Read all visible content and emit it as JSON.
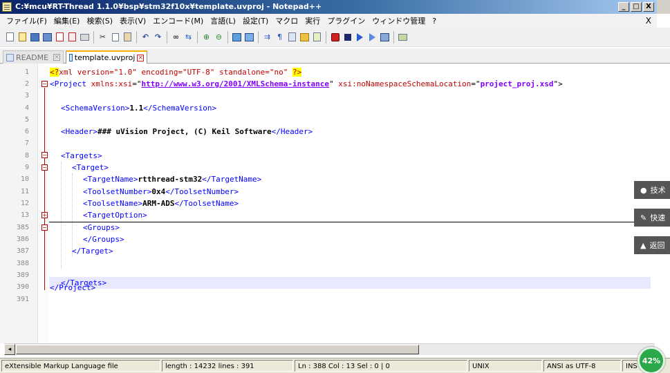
{
  "window": {
    "title": "C:¥mcu¥RT-Thread 1.1.0¥bsp¥stm32f10x¥template.uvproj - Notepad++",
    "buttons": [
      "_",
      "□",
      "X"
    ]
  },
  "menubar": {
    "items": [
      "ファイル(F)",
      "編集(E)",
      "検索(S)",
      "表示(V)",
      "エンコード(M)",
      "言語(L)",
      "設定(T)",
      "マクロ",
      "実行",
      "プラグイン",
      "ウィンドウ管理",
      "?"
    ],
    "close_label": "X"
  },
  "toolbar": {
    "icons": [
      "new-file-icon",
      "open-file-icon",
      "save-icon",
      "save-all-icon",
      "close-icon",
      "close-all-icon",
      "print-icon",
      "cut-icon",
      "copy-icon",
      "paste-icon",
      "undo-icon",
      "redo-icon",
      "find-icon",
      "replace-icon",
      "zoom-in-icon",
      "zoom-out-icon",
      "sync-v-icon",
      "sync-h-icon",
      "word-wrap-icon",
      "show-all-chars-icon",
      "indent-guide-icon",
      "doc-map-icon",
      "function-list-icon",
      "record-macro-icon",
      "stop-macro-icon",
      "play-macro-icon",
      "run-macro-multiple-icon",
      "save-macro-icon",
      "spellcheck-icon"
    ]
  },
  "tabs": [
    {
      "label": "README",
      "active": false
    },
    {
      "label": "template.uvproj",
      "active": true
    }
  ],
  "editor": {
    "line_numbers": [
      "1",
      "2",
      "3",
      "4",
      "5",
      "6",
      "7",
      "8",
      "9",
      "10",
      "11",
      "12",
      "13",
      "385",
      "386",
      "387",
      "388",
      "389",
      "390",
      "391"
    ],
    "current_line": "388",
    "code": {
      "l1": {
        "pi_open": "<?",
        "body": "xml version=\"1.0\" encoding=\"UTF-8\" standalone=\"no\" ",
        "pi_close": "?>"
      },
      "l2": {
        "tag": "<Project ",
        "attr1": "xmlns:xsi",
        "eq1": "=\"",
        "val1": "http://www.w3.org/2001/XMLSchema-instance",
        "q1": "\" ",
        "attr2": "xsi:noNamespaceSchemaLocation",
        "eq2": "=\"",
        "val2": "project_proj.xsd",
        "end": "\">"
      },
      "l4": {
        "open": "<SchemaVersion>",
        "text": "1.1",
        "close": "</SchemaVersion>"
      },
      "l6": {
        "open": "<Header>",
        "text": "### uVision Project, (C) Keil Software",
        "close": "</Header>"
      },
      "l8": {
        "tag": "<Targets>"
      },
      "l9": {
        "tag": "<Target>"
      },
      "l10": {
        "open": "<TargetName>",
        "text": "rtthread-stm32",
        "close": "</TargetName>"
      },
      "l11": {
        "open": "<ToolsetNumber>",
        "text": "0x4",
        "close": "</ToolsetNumber>"
      },
      "l12": {
        "open": "<ToolsetName>",
        "text": "ARM-ADS",
        "close": "</ToolsetName>"
      },
      "l13": {
        "tag": "<TargetOption>"
      },
      "l385": {
        "tag": "<Groups>"
      },
      "l386": {
        "tag": "</Groups>"
      },
      "l387": {
        "tag": "</Target>"
      },
      "l388": {
        "tag": "</Targets>"
      },
      "l390": {
        "tag": "</Project>"
      }
    }
  },
  "statusbar": {
    "file_type": "eXtensible Markup Language file",
    "length": "length : 14232    lines : 391",
    "position": "Ln : 388    Col : 13    Sel : 0 | 0",
    "eol": "UNIX",
    "encoding": "ANSI as UTF-8",
    "mode": "INS"
  },
  "side_widgets": [
    {
      "label": "技术",
      "icon": "chat-bubble-icon"
    },
    {
      "label": "快速",
      "icon": "pencil-icon"
    },
    {
      "label": "返回",
      "icon": "chevron-up-icon"
    }
  ],
  "progress_badge": {
    "label": "42%",
    "value": 42
  }
}
